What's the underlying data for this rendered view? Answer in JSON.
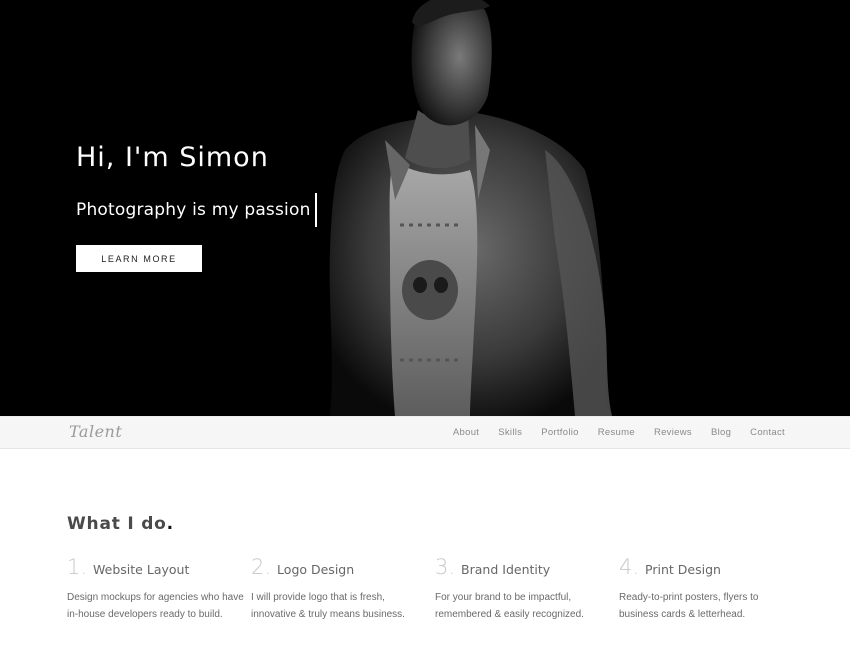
{
  "hero": {
    "title": "Hi, I'm Simon",
    "subtitle": "Photography is my passion",
    "button_label": "LEARN MORE"
  },
  "navbar": {
    "logo": "Talent",
    "items": [
      "About",
      "Skills",
      "Portfolio",
      "Resume",
      "Reviews",
      "Blog",
      "Contact"
    ]
  },
  "services": {
    "title": "What I do",
    "title_dot": ".",
    "items": [
      {
        "number": "1.",
        "name": "Website Layout",
        "line1": "Design mockups for agencies who have",
        "line2": "in-house developers ready to build."
      },
      {
        "number": "2.",
        "name": "Logo Design",
        "line1": "I will provide logo that is fresh,",
        "line2": "innovative & truly means business."
      },
      {
        "number": "3.",
        "name": "Brand Identity",
        "line1": "For your brand to be impactful,",
        "line2": "remembered & easily recognized."
      },
      {
        "number": "4.",
        "name": "Print Design",
        "line1": "Ready-to-print posters, flyers to",
        "line2": "business cards & letterhead."
      }
    ]
  },
  "colors": {
    "hero_bg": "#000000",
    "navbar_bg": "#f6f6f6",
    "number_gray": "#c8c8c8"
  }
}
